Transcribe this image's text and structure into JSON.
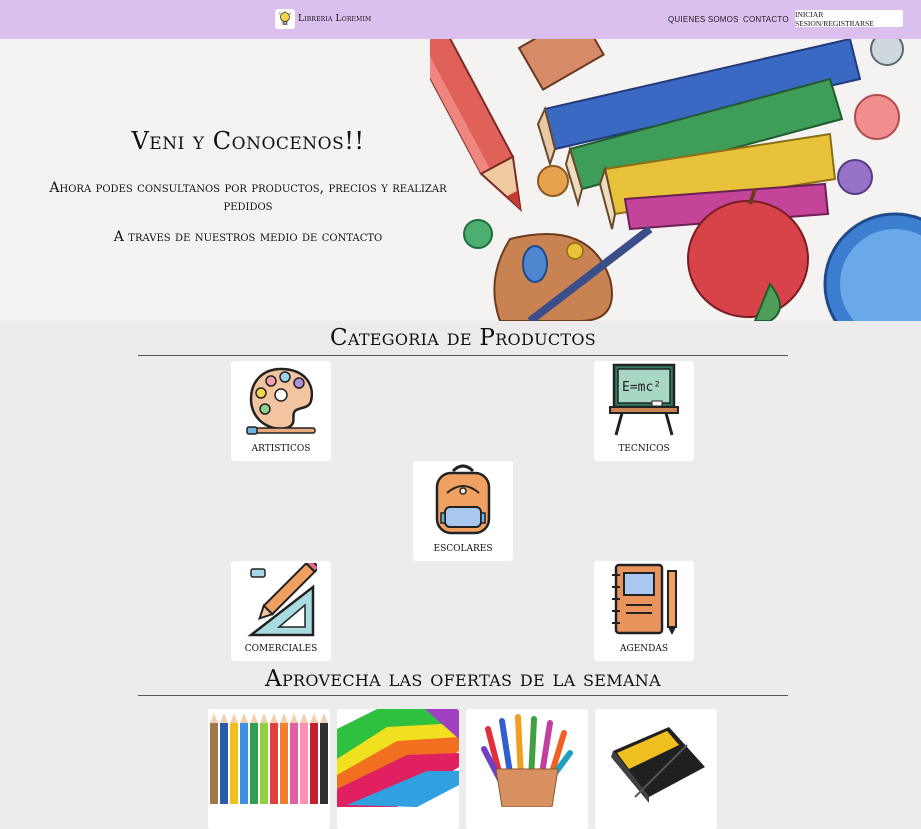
{
  "nav": {
    "brand": "Libreria Loremim",
    "links": [
      "QUIENES SOMOS",
      "CONTACTO"
    ],
    "login_button": "INICIAR SESION/REGISTRARSE"
  },
  "hero": {
    "title": "Veni y Conocenos!!",
    "subtitle": "Ahora podes consultanos por productos, precios y realizar pedidos",
    "subtitle2": "A traves de nuestros medio de contacto"
  },
  "categories": {
    "title": "Categoria de Productos",
    "items": [
      {
        "label": "ARTISTICOS",
        "icon": "palette-icon"
      },
      {
        "label": "TECNICOS",
        "icon": "blackboard-icon"
      },
      {
        "label": "ESCOLARES",
        "icon": "backpack-icon"
      },
      {
        "label": "COMERCIALES",
        "icon": "ruler-pencil-icon"
      },
      {
        "label": "AGENDAS",
        "icon": "notebook-icon"
      }
    ]
  },
  "offers": {
    "title": "Aprovecha las ofertas de la semana",
    "items": [
      {
        "image": "colored-pencils"
      },
      {
        "image": "colored-folders"
      },
      {
        "image": "markers-cup"
      },
      {
        "image": "black-notebook"
      }
    ]
  }
}
